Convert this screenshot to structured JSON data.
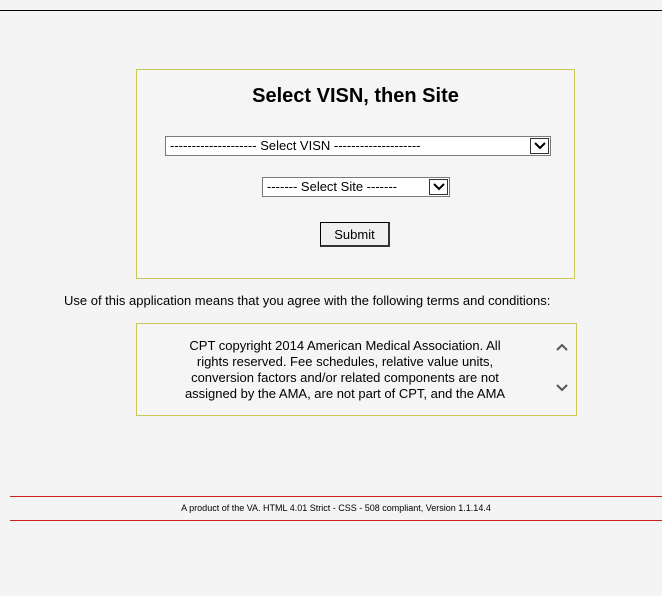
{
  "form": {
    "title": "Select VISN, then Site",
    "visn_select": "-------------------- Select VISN --------------------",
    "site_select": "------- Select Site -------",
    "submit_label": "Submit"
  },
  "terms": {
    "intro": "Use of this application means that you agree with the following terms and conditions:",
    "text_lines": [
      "CPT copyright 2014 American Medical Association. All",
      "rights reserved. Fee schedules, relative value units,",
      "conversion factors and/or related components are not",
      "assigned by the AMA, are not part of CPT, and the AMA"
    ]
  },
  "footer": {
    "text": "A product of the VA. HTML 4.01 Strict - CSS - 508 compliant, Version 1.1.14.4"
  },
  "colors": {
    "panel_border": "#c8c85a",
    "footer_rule": "#cc2222"
  }
}
